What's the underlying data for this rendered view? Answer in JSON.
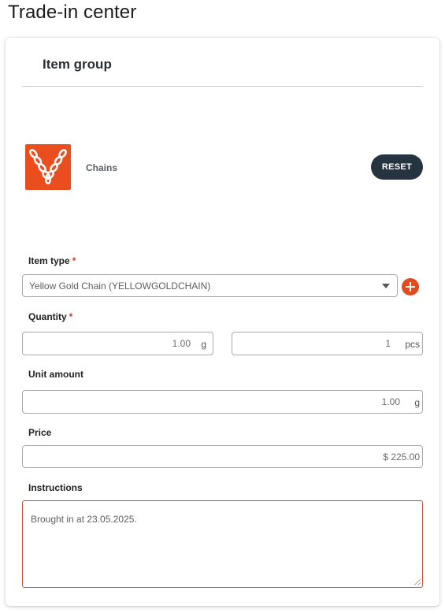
{
  "page": {
    "title": "Trade-in center"
  },
  "item_group": {
    "title": "Item group",
    "item_name": "Chains",
    "item_icon": "chain-icon",
    "icon_bg_color": "#ea4e1f",
    "reset_label": "RESET"
  },
  "form": {
    "item_type": {
      "label": "Item type",
      "required_mark": "*",
      "value": "Yellow Gold Chain (YELLOWGOLDCHAIN)"
    },
    "quantity": {
      "label": "Quantity",
      "required_mark": "*",
      "weight_value": "1.00",
      "weight_unit": "g",
      "pieces_value": "1",
      "pieces_unit": "pcs"
    },
    "unit_amount": {
      "label": "Unit amount",
      "value": "1.00",
      "unit": "g"
    },
    "price": {
      "label": "Price",
      "value": "$ 225.00"
    },
    "instructions": {
      "label": "Instructions",
      "value": "Brought in at 23.05.2025."
    }
  },
  "colors": {
    "accent": "#e24a1f",
    "button_dark": "#263341",
    "required": "#d0352a"
  }
}
